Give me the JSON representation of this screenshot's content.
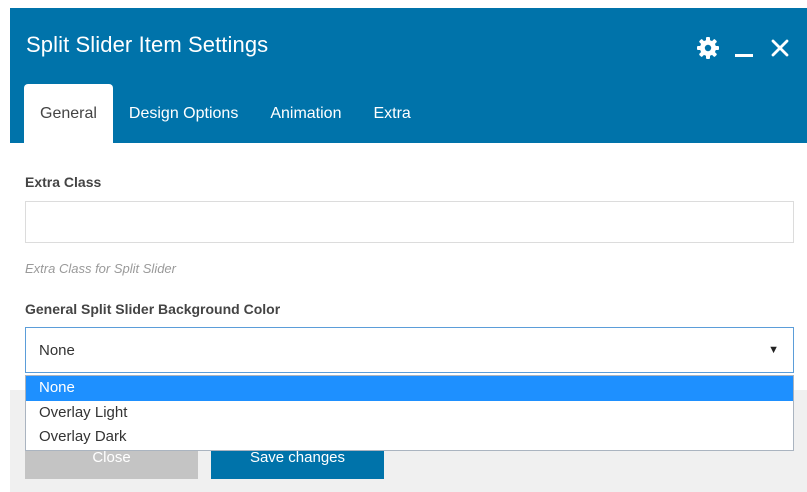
{
  "dialog": {
    "title": "Split Slider Item Settings",
    "icons": [
      "gear-icon",
      "minimize-icon",
      "close-icon"
    ]
  },
  "tabs": [
    {
      "label": "General",
      "active": true
    },
    {
      "label": "Design Options",
      "active": false
    },
    {
      "label": "Animation",
      "active": false
    },
    {
      "label": "Extra",
      "active": false
    }
  ],
  "form": {
    "extra_class": {
      "label": "Extra Class",
      "value": "",
      "help": "Extra Class for Split Slider"
    },
    "bg_color": {
      "label": "General Split Slider Background Color",
      "selected": "None",
      "options": [
        "None",
        "Overlay Light",
        "Overlay Dark"
      ]
    }
  },
  "footer": {
    "close_label": "Close",
    "save_label": "Save changes"
  },
  "colors": {
    "header": "#0073aa",
    "option_highlight": "#1e90ff",
    "close_button": "#c4c4c4"
  }
}
